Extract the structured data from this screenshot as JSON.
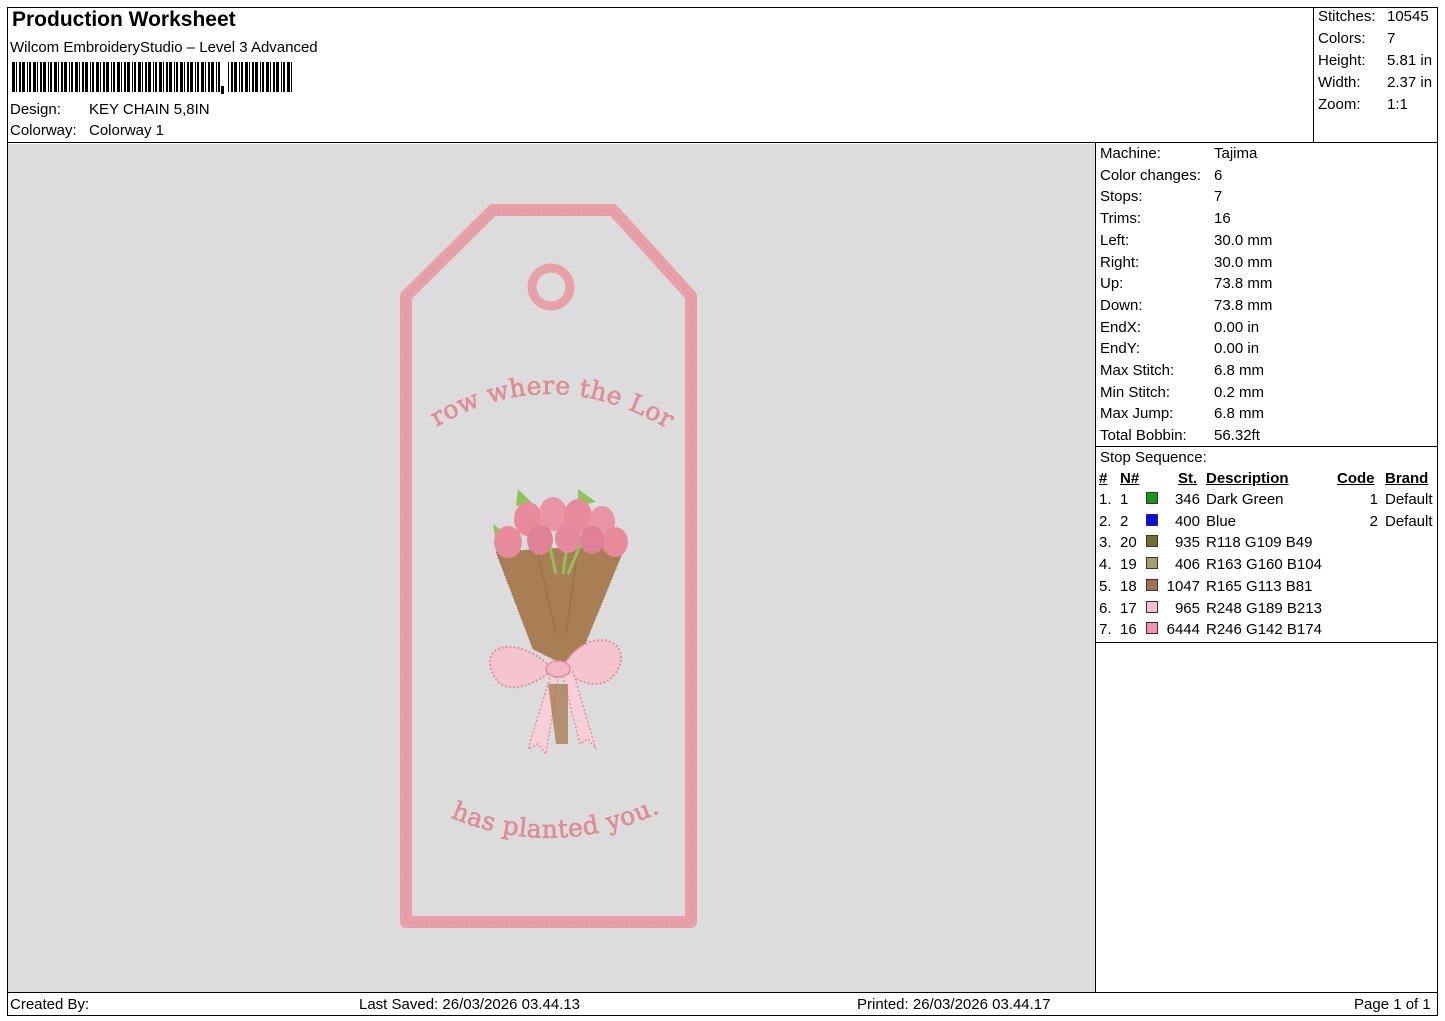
{
  "header": {
    "title": "Production Worksheet",
    "software": "Wilcom EmbroideryStudio – Level 3 Advanced",
    "design_label": "Design:",
    "design_value": "KEY CHAIN 5,8IN",
    "colorway_label": "Colorway:",
    "colorway_value": "Colorway 1"
  },
  "stats": [
    {
      "label": "Stitches:",
      "value": "10545"
    },
    {
      "label": "Colors:",
      "value": "7"
    },
    {
      "label": "Height:",
      "value": "5.81 in"
    },
    {
      "label": "Width:",
      "value": "2.37 in"
    },
    {
      "label": "Zoom:",
      "value": "1:1"
    }
  ],
  "machine_info": [
    {
      "label": "Machine:",
      "value": "Tajima"
    },
    {
      "label": "Color changes:",
      "value": "6"
    },
    {
      "label": "Stops:",
      "value": "7"
    },
    {
      "label": "Trims:",
      "value": "16"
    },
    {
      "label": "Left:",
      "value": "30.0 mm"
    },
    {
      "label": "Right:",
      "value": "30.0 mm"
    },
    {
      "label": "Up:",
      "value": "73.8 mm"
    },
    {
      "label": "Down:",
      "value": "73.8 mm"
    },
    {
      "label": "EndX:",
      "value": "0.00 in"
    },
    {
      "label": "EndY:",
      "value": "0.00 in"
    },
    {
      "label": "Max Stitch:",
      "value": "6.8 mm"
    },
    {
      "label": "Min Stitch:",
      "value": "0.2 mm"
    },
    {
      "label": "Max Jump:",
      "value": "6.8 mm"
    },
    {
      "label": "Total Bobbin:",
      "value": "56.32ft"
    }
  ],
  "stop_sequence": {
    "title": "Stop Sequence:",
    "columns": {
      "num": "#",
      "needle": "N#",
      "st": "St.",
      "desc": "Description",
      "code": "Code",
      "brand": "Brand"
    },
    "rows": [
      {
        "num": "1.",
        "needle": "1",
        "color": "#129a12",
        "st": "346",
        "desc": "Dark Green",
        "code": "1",
        "brand": "Default"
      },
      {
        "num": "2.",
        "needle": "2",
        "color": "#0a0af0",
        "st": "400",
        "desc": "Blue",
        "code": "2",
        "brand": "Default"
      },
      {
        "num": "3.",
        "needle": "20",
        "color": "#766d31",
        "st": "935",
        "desc": "R118 G109 B49",
        "code": "",
        "brand": ""
      },
      {
        "num": "4.",
        "needle": "19",
        "color": "#a3a068",
        "st": "406",
        "desc": "R163 G160 B104",
        "code": "",
        "brand": ""
      },
      {
        "num": "5.",
        "needle": "18",
        "color": "#a57151",
        "st": "1047",
        "desc": "R165 G113 B81",
        "code": "",
        "brand": ""
      },
      {
        "num": "6.",
        "needle": "17",
        "color": "#f8bdd5",
        "st": "965",
        "desc": "R248 G189 B213",
        "code": "",
        "brand": ""
      },
      {
        "num": "7.",
        "needle": "16",
        "color": "#f68eae",
        "st": "6444",
        "desc": "R246 G142 B174",
        "code": "",
        "brand": ""
      }
    ]
  },
  "design_preview": {
    "text_top": "Grow where the Lord",
    "text_bottom": "has planted you.",
    "outline_color": "#e8a0a8",
    "bag_color": "#a97e55",
    "leaf_color": "#8fc25a",
    "flower_color": "#e78a9c"
  },
  "footer": {
    "created_by": "Created By:",
    "last_saved": "Last Saved: 26/03/2026 03.44.13",
    "printed": "Printed: 26/03/2026 03.44.17",
    "page": "Page 1 of 1"
  }
}
